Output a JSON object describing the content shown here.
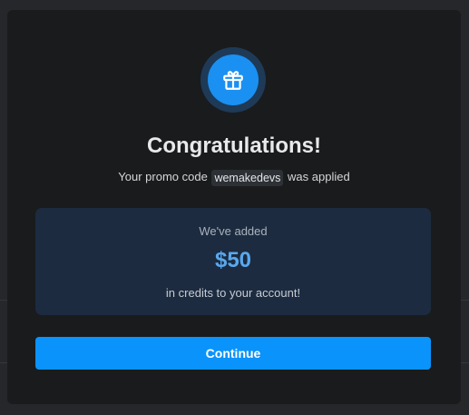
{
  "modal": {
    "icon": "gift-icon",
    "title": "Congratulations!",
    "subtitle_prefix": "Your promo code",
    "promo_code": "wemakedevs",
    "subtitle_suffix": "was applied",
    "credit": {
      "intro": "We've added",
      "amount": "$50",
      "note": "in credits to your account!"
    },
    "continue_label": "Continue"
  },
  "colors": {
    "page_background": "#25272a",
    "modal_background": "#191b1d",
    "accent": "#0a93fb",
    "credit_box": "#1c2b40",
    "amount_text": "#59a8ee"
  }
}
